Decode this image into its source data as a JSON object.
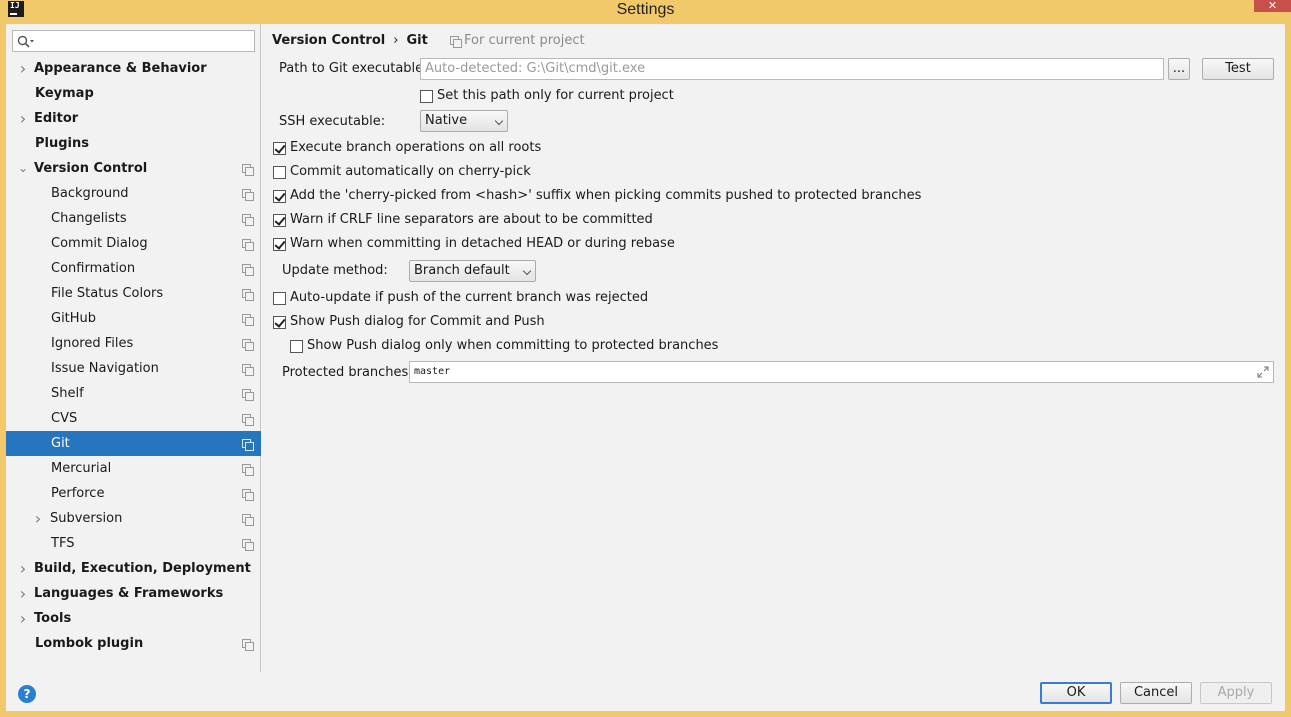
{
  "window": {
    "title": "Settings",
    "app_icon": "intellij-icon",
    "close_glyph": "✕"
  },
  "sidebar": {
    "search": {
      "placeholder": ""
    },
    "items": [
      {
        "label": "Appearance & Behavior",
        "bold": true,
        "arrow": "right"
      },
      {
        "label": "Keymap",
        "bold": true
      },
      {
        "label": "Editor",
        "bold": true,
        "arrow": "right"
      },
      {
        "label": "Plugins",
        "bold": true
      },
      {
        "label": "Version Control",
        "bold": true,
        "arrow": "down",
        "project": true
      },
      {
        "label": "Background",
        "project": true
      },
      {
        "label": "Changelists",
        "project": true
      },
      {
        "label": "Commit Dialog",
        "project": true
      },
      {
        "label": "Confirmation",
        "project": true
      },
      {
        "label": "File Status Colors",
        "project": true
      },
      {
        "label": "GitHub",
        "project": true
      },
      {
        "label": "Ignored Files",
        "project": true
      },
      {
        "label": "Issue Navigation",
        "project": true
      },
      {
        "label": "Shelf",
        "project": true
      },
      {
        "label": "CVS",
        "project": true
      },
      {
        "label": "Git",
        "project": true,
        "selected": true
      },
      {
        "label": "Mercurial",
        "project": true
      },
      {
        "label": "Perforce",
        "project": true
      },
      {
        "label": "Subversion",
        "project": true,
        "arrow": "right"
      },
      {
        "label": "TFS",
        "project": true
      },
      {
        "label": "Build, Execution, Deployment",
        "bold": true,
        "arrow": "right"
      },
      {
        "label": "Languages & Frameworks",
        "bold": true,
        "arrow": "right"
      },
      {
        "label": "Tools",
        "bold": true,
        "arrow": "right"
      },
      {
        "label": "Lombok plugin",
        "bold": true,
        "project": true
      }
    ]
  },
  "breadcrumb": {
    "parent": "Version Control",
    "separator": "›",
    "current": "Git",
    "scope": "For current project"
  },
  "git": {
    "path_label": "Path to Git executable:",
    "path_placeholder": "Auto-detected: G:\\Git\\cmd\\git.exe",
    "browse_label": "...",
    "test_label": "Test",
    "set_path_only": {
      "label": "Set this path only for current project",
      "checked": false
    },
    "ssh_label": "SSH executable:",
    "ssh_value": "Native",
    "options": [
      {
        "label": "Execute branch operations on all roots",
        "checked": true
      },
      {
        "label": "Commit automatically on cherry-pick",
        "checked": false
      },
      {
        "label": "Add the 'cherry-picked from <hash>' suffix when picking commits pushed to protected branches",
        "checked": true
      },
      {
        "label": "Warn if CRLF line separators are about to be committed",
        "checked": true
      },
      {
        "label": "Warn when committing in detached HEAD or during rebase",
        "checked": true
      }
    ],
    "update_method_label": "Update method:",
    "update_method_value": "Branch default",
    "auto_update": {
      "label": "Auto-update if push of the current branch was rejected",
      "checked": false
    },
    "show_push": {
      "label": "Show Push dialog for Commit and Push",
      "checked": true
    },
    "show_push_protected": {
      "label": "Show Push dialog only when committing to protected branches",
      "checked": false
    },
    "protected_label": "Protected branches:",
    "protected_value": "master"
  },
  "footer": {
    "help": "?",
    "ok": "OK",
    "cancel": "Cancel",
    "apply": "Apply"
  },
  "colors": {
    "selection": "#2675bf",
    "title_bar": "#f1c96a",
    "close": "#c7504a",
    "help": "#2b7fd0"
  }
}
